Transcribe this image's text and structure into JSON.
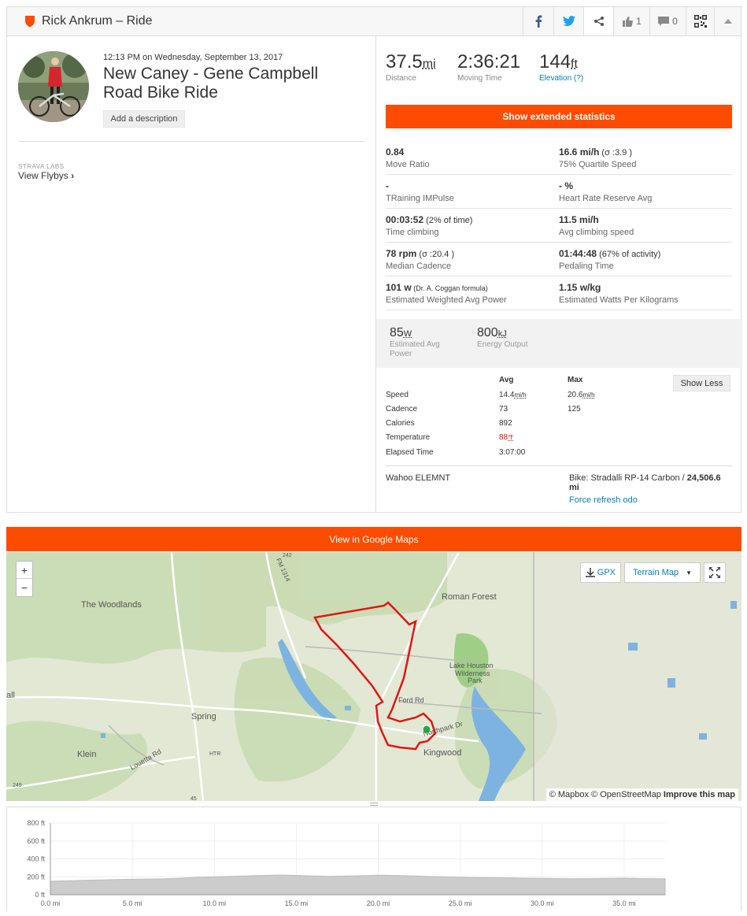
{
  "header": {
    "title": "Rick Ankrum – Ride",
    "kudos_count": "1",
    "comments_count": "0"
  },
  "activity": {
    "datetime": "12:13 PM on Wednesday, September 13, 2017",
    "name": "New Caney - Gene Campbell Road Bike Ride",
    "add_description": "Add a description",
    "labs_label": "STRAVA LABS",
    "view_flybys": "View Flybys"
  },
  "summary": {
    "distance": {
      "value": "37.5",
      "unit": "mi",
      "label": "Distance"
    },
    "moving_time": {
      "value": "2:36:21",
      "label": "Moving Time"
    },
    "elevation": {
      "value": "144",
      "unit": "ft",
      "label": "Elevation (?)"
    }
  },
  "extended_button": "Show extended statistics",
  "stats": [
    [
      {
        "value": "0.84",
        "extra": "",
        "label": "Move Ratio"
      },
      {
        "value": "16.6 mi/h",
        "extra": " (σ :3.9 )",
        "label": "75% Quartile Speed"
      }
    ],
    [
      {
        "value": "-",
        "extra": "",
        "label": "TRaining IMPulse"
      },
      {
        "value": "- %",
        "extra": "",
        "label": "Heart Rate Reserve Avg"
      }
    ],
    [
      {
        "value": "00:03:52",
        "extra": " (2% of time)",
        "label": "Time climbing"
      },
      {
        "value": "11.5 mi/h",
        "extra": "",
        "label": "Avg climbing speed"
      }
    ],
    [
      {
        "value": "78 rpm",
        "extra": " (σ :20.4 )",
        "label": "Median Cadence"
      },
      {
        "value": "01:44:48",
        "extra": " (67% of activity)",
        "label": "Pedaling Time"
      }
    ],
    [
      {
        "value": "101 w",
        "small": " (Dr. A. Coggan formula)",
        "label": "Estimated Weighted Avg Power"
      },
      {
        "value": "1.15 w/kg",
        "extra": "",
        "label": "Estimated Watts Per Kilograms"
      }
    ]
  ],
  "power": {
    "avg_power": {
      "value": "85",
      "unit": "W",
      "label": "Estimated Avg Power"
    },
    "energy": {
      "value": "800",
      "unit": "kJ",
      "label": "Energy Output"
    }
  },
  "details": {
    "avg_header": "Avg",
    "max_header": "Max",
    "show_less": "Show Less",
    "rows": [
      {
        "label": "Speed",
        "avg": "14.4",
        "avg_unit": "mi/h",
        "max": "20.6",
        "max_unit": "mi/h"
      },
      {
        "label": "Cadence",
        "avg": "73",
        "max": "125"
      },
      {
        "label": "Calories",
        "avg": "892",
        "max": ""
      },
      {
        "label": "Temperature",
        "avg": "88",
        "avg_unit": "℉",
        "max": ""
      },
      {
        "label": "Elapsed Time",
        "avg": "3:07:00",
        "max": ""
      }
    ],
    "device": "Wahoo ELEMNT",
    "bike_prefix": "Bike: Stradalli RP-14 Carbon / ",
    "bike_odo": "24,506.6 mi",
    "force_refresh": "Force refresh odo"
  },
  "map": {
    "google_button": "View in Google Maps",
    "gpx": "GPX",
    "map_type": "Terrain Map",
    "zoom_in": "+",
    "zoom_out": "−",
    "labels": [
      "The Woodlands",
      "Roman Forest",
      "Lake Houston",
      "Wilderness",
      "Park",
      "Spring",
      "Klein",
      "Kingwood",
      "Ford Rd",
      "Northpark Dr",
      "Louetta Rd",
      "all",
      "HTR",
      "45",
      "249",
      "242",
      "FM 1314"
    ],
    "attribution_a": "© Mapbox © OpenStreetMap ",
    "attribution_b": "Improve this map"
  },
  "chart_data": {
    "type": "area",
    "title": "",
    "xlabel": "",
    "ylabel": "",
    "x_ticks": [
      "0.0 mi",
      "5.0 mi",
      "10.0 mi",
      "15.0 mi",
      "20.0 mi",
      "25.0 mi",
      "30.0 mi",
      "35.0 mi"
    ],
    "y_ticks": [
      "800 ft",
      "600 ft",
      "400 ft",
      "200 ft",
      "0 ft"
    ],
    "xlim": [
      0,
      37.5
    ],
    "ylim": [
      0,
      800
    ],
    "x": [
      0,
      1,
      2,
      3,
      4,
      5,
      6,
      7,
      8,
      9,
      10,
      11,
      12,
      13,
      14,
      15,
      16,
      17,
      18,
      19,
      20,
      21,
      22,
      23,
      24,
      25,
      26,
      27,
      28,
      29,
      30,
      31,
      32,
      33,
      34,
      35,
      36,
      37.5
    ],
    "values": [
      150,
      155,
      160,
      165,
      170,
      172,
      175,
      178,
      185,
      195,
      200,
      205,
      210,
      215,
      220,
      215,
      210,
      205,
      208,
      212,
      218,
      215,
      210,
      205,
      200,
      195,
      192,
      190,
      188,
      185,
      182,
      180,
      178,
      180,
      182,
      185,
      180,
      178
    ]
  }
}
